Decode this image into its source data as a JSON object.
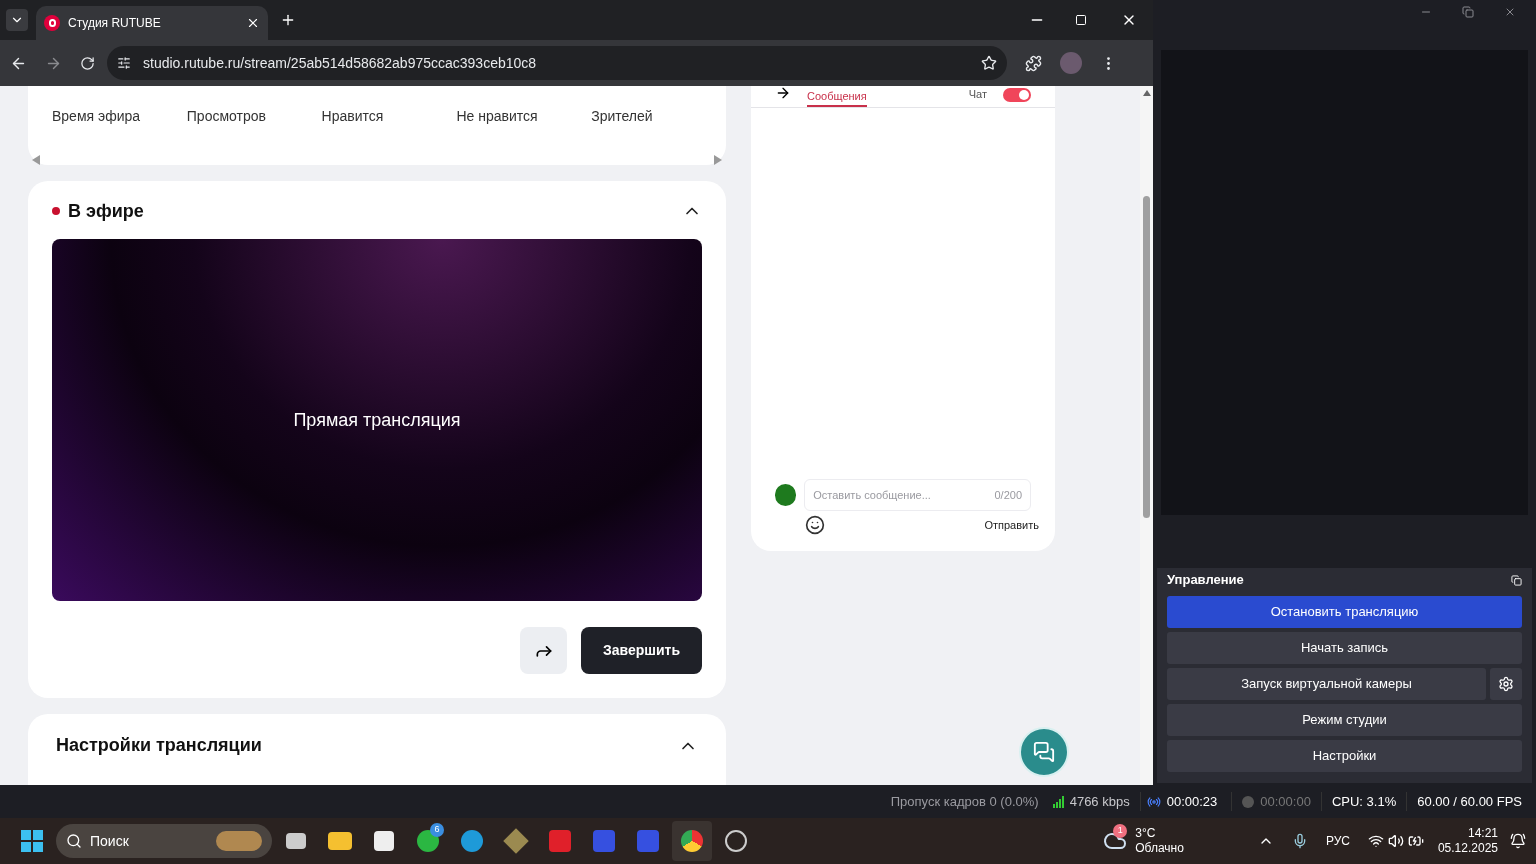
{
  "browser": {
    "tab_title": "Студия RUTUBE",
    "url": "studio.rutube.ru/stream/25ab514d58682ab975ccac393ceb10c8"
  },
  "stats": [
    {
      "label": "Время эфира"
    },
    {
      "label": "Просмотров"
    },
    {
      "label": "Нравится"
    },
    {
      "label": "Не нравится"
    },
    {
      "label": "Зрителей"
    }
  ],
  "live": {
    "title": "В эфире",
    "expanded": true,
    "video_caption": "Прямая трансляция",
    "end_button": "Завершить"
  },
  "settings_section": {
    "title": "Настройки трансляции",
    "expanded": true
  },
  "chat": {
    "tab": {
      "label": "Сообщения",
      "selected": true
    },
    "toggle": {
      "label": "Чат",
      "on": true
    },
    "input": {
      "placeholder": "Оставить сообщение...",
      "counter": "0/200"
    },
    "send_button": "Отправить"
  },
  "obs": {
    "panel_title": "Управление",
    "buttons": [
      {
        "label": "Остановить трансляцию",
        "active": true,
        "settings": false
      },
      {
        "label": "Начать запись",
        "active": false,
        "settings": false
      },
      {
        "label": "Запуск виртуальной камеры",
        "active": false,
        "settings": true
      },
      {
        "label": "Режим студии",
        "active": false,
        "settings": false
      },
      {
        "label": "Настройки",
        "active": false,
        "settings": false
      }
    ]
  },
  "status_bar": {
    "dropped_frames": "Пропуск кадров 0 (0.0%)",
    "bitrate": "4766 kbps",
    "stream_time": "00:00:23",
    "record_time": "00:00:00",
    "cpu": "CPU: 3.1%",
    "fps": "60.00 / 60.00 FPS"
  },
  "taskbar": {
    "search_placeholder": "Поиск",
    "whatsapp_badge": "6",
    "weather": {
      "badge": "1",
      "temp": "3°C",
      "condition": "Облачно"
    },
    "language": "РУС",
    "time": "14:21",
    "date": "05.12.2025"
  }
}
